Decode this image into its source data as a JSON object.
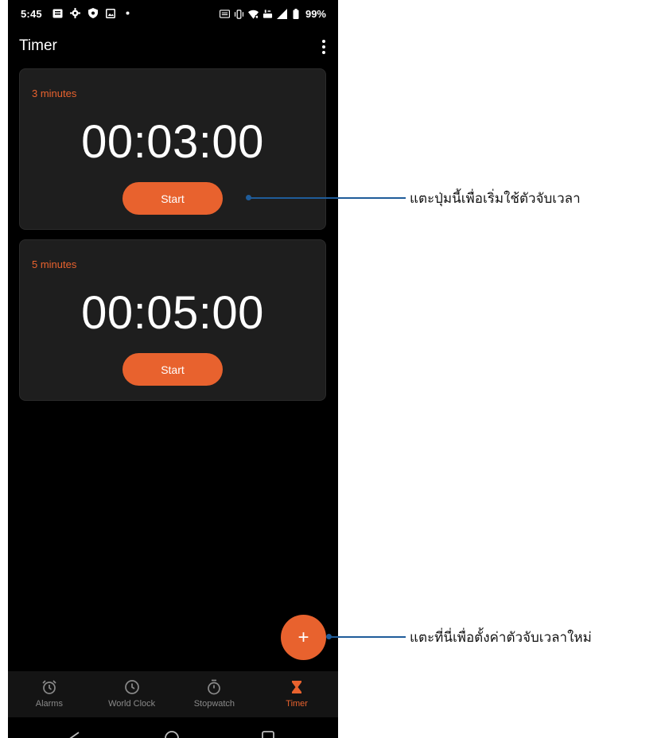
{
  "status_bar": {
    "time": "5:45",
    "battery": "99%"
  },
  "app_bar": {
    "title": "Timer"
  },
  "timers": [
    {
      "label": "3 minutes",
      "time": "00:03:00",
      "start_label": "Start"
    },
    {
      "label": "5 minutes",
      "time": "00:05:00",
      "start_label": "Start"
    }
  ],
  "fab": {
    "icon": "plus-icon",
    "label": "+"
  },
  "bottom_nav": {
    "items": [
      {
        "label": "Alarms",
        "icon": "alarm-icon",
        "active": false
      },
      {
        "label": "World Clock",
        "icon": "clock-icon",
        "active": false
      },
      {
        "label": "Stopwatch",
        "icon": "stopwatch-icon",
        "active": false
      },
      {
        "label": "Timer",
        "icon": "hourglass-icon",
        "active": true
      }
    ]
  },
  "annotations": {
    "start_hint": "แตะปุ่มนี้เพื่อเริ่มใช้ตัวจับเวลา",
    "add_hint": "แตะที่นี่เพื่อตั้งค่าตัวจับเวลาใหม่"
  },
  "colors": {
    "accent": "#e8622e",
    "background": "#000000",
    "card": "#1e1e1e",
    "callout": "#1f5c9a"
  }
}
